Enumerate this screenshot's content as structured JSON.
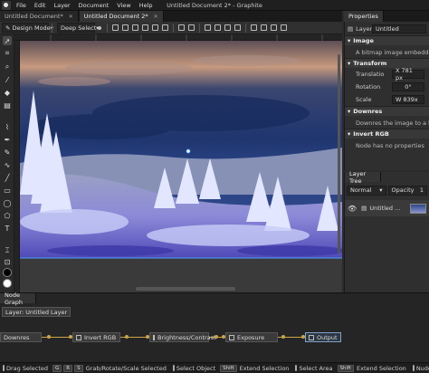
{
  "window": {
    "title": "Untitled Document 2* - Graphite",
    "menu": [
      "File",
      "Edit",
      "Layer",
      "Document",
      "View",
      "Help"
    ]
  },
  "tabs": [
    {
      "label": "Untitled Document*",
      "active": false
    },
    {
      "label": "Untitled Document 2*",
      "active": true
    }
  ],
  "right_tab": "Properties",
  "options_bar": {
    "mode": "Design Mode",
    "select_mode": "Deep Select"
  },
  "properties": {
    "layer_label": "Layer",
    "layer_name": "Untitled",
    "image_section": "Image",
    "image_desc": "A bitmap image embedded in t",
    "transform_section": "Transform",
    "translation_label": "Translatio",
    "translation_x": "X 781 px",
    "rotation_label": "Rotation",
    "rotation_value": "0°",
    "scale_label": "Scale",
    "scale_w": "W 839x",
    "downres_section": "Downres",
    "downres_desc": "Downres the image to a lower r",
    "invert_section": "Invert RGB",
    "invert_desc": "Node has no properties"
  },
  "layer_tree": {
    "title": "Layer Tree",
    "blend": "Normal",
    "opacity_label": "Opacity",
    "opacity_value": "1",
    "layer_name": "Untitled ..."
  },
  "node_graph": {
    "title": "Node Graph",
    "breadcrumb": "Layer: Untitled Layer",
    "nodes": [
      "Downres",
      "Invert RGB",
      "Brightness/Contrast",
      "Exposure",
      "Output"
    ]
  },
  "status": [
    {
      "keys": [],
      "label": "Drag Selected"
    },
    {
      "keys": [
        "G",
        "R",
        "S"
      ],
      "label": "Grab/Rotate/Scale Selected"
    },
    {
      "keys": [],
      "label": "Select Object"
    },
    {
      "keys": [
        "Shift"
      ],
      "label": "Extend Selection"
    },
    {
      "keys": [],
      "label": "Select Area"
    },
    {
      "keys": [
        "Shift"
      ],
      "label": "Extend Selection"
    },
    {
      "keys": [],
      "label": "Nudge Se"
    }
  ],
  "colors": {
    "accent": "#7fa3c8",
    "wire": "#c9a548",
    "sky_top": "#6a5a66",
    "sky_mid": "#233a78",
    "hills": "#8a94b8",
    "snow": "#dfe4ff",
    "grass": "#5a55b8"
  }
}
